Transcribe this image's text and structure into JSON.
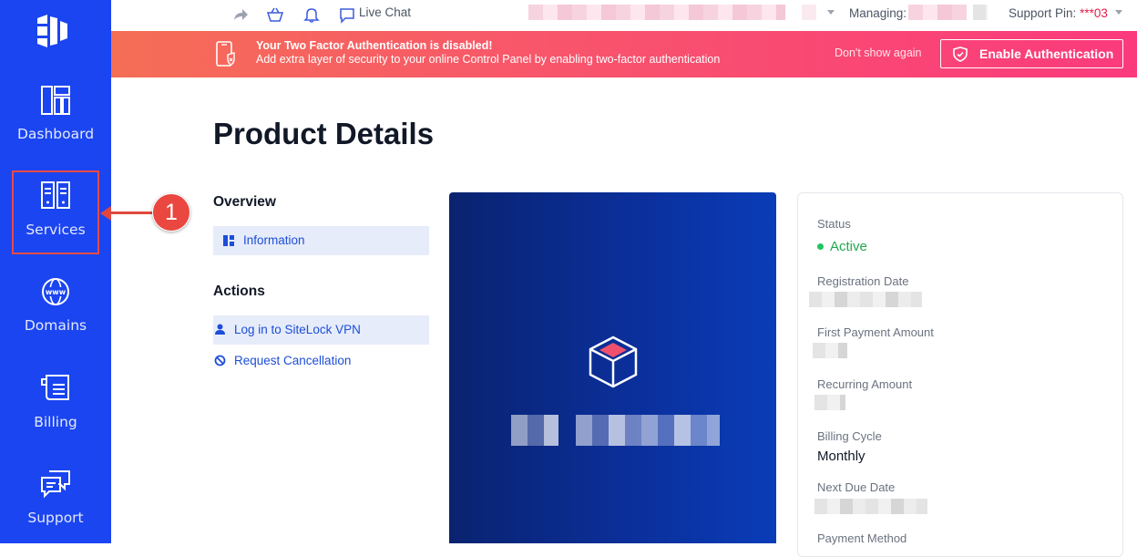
{
  "sidebar": {
    "items": [
      {
        "label": "Dashboard",
        "icon": "dashboard-icon"
      },
      {
        "label": "Services",
        "icon": "services-icon"
      },
      {
        "label": "Domains",
        "icon": "www-globe-icon"
      },
      {
        "label": "Billing",
        "icon": "invoice-icon"
      },
      {
        "label": "Support",
        "icon": "chat-bubbles-icon"
      }
    ]
  },
  "annotation": {
    "number": "1"
  },
  "topbar": {
    "live_chat": "Live Chat",
    "managing_label": "Managing:",
    "support_pin_label": "Support Pin:",
    "support_pin_value": "***03"
  },
  "banner": {
    "title": "Your Two Factor Authentication is disabled!",
    "message": "Add extra layer of security to your online Control Panel by enabling two-factor authentication",
    "dismiss": "Don't show again",
    "button": "Enable Authentication"
  },
  "page": {
    "title": "Product Details"
  },
  "overview": {
    "heading": "Overview",
    "items": [
      {
        "label": "Information"
      }
    ]
  },
  "actions": {
    "heading": "Actions",
    "items": [
      {
        "label": "Log in to SiteLock VPN"
      },
      {
        "label": "Request Cancellation"
      }
    ]
  },
  "details": {
    "status_label": "Status",
    "status_value": "Active",
    "registration_date_label": "Registration Date",
    "first_payment_label": "First Payment Amount",
    "recurring_amount_label": "Recurring Amount",
    "billing_cycle_label": "Billing Cycle",
    "billing_cycle_value": "Monthly",
    "next_due_date_label": "Next Due Date",
    "payment_method_label": "Payment Method"
  },
  "colors": {
    "sidebar": "#1b45f0",
    "banner_start": "#f56e56",
    "banner_end": "#fb3a7d",
    "link": "#1d4ed8",
    "status_active": "#22a84f",
    "annotation": "#e9473f"
  }
}
